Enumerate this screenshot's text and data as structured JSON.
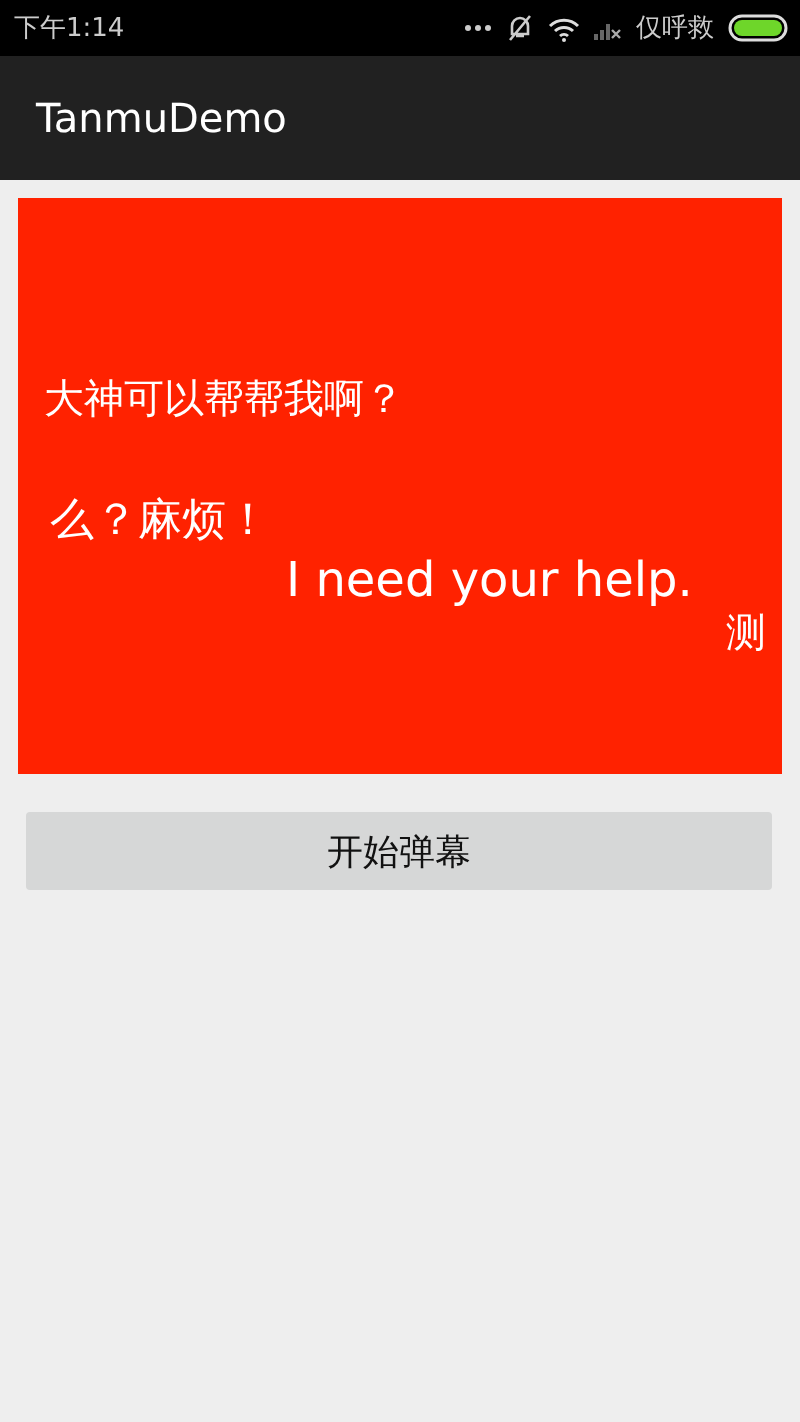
{
  "status_bar": {
    "time": "下午1:14",
    "carrier_text": "仅呼救"
  },
  "app_bar": {
    "title": "TanmuDemo"
  },
  "danmaku": [
    {
      "text": "大神可以帮帮我啊？"
    },
    {
      "text": "么？麻烦！"
    },
    {
      "text": "I need your help."
    },
    {
      "text": "测"
    }
  ],
  "buttons": [
    {
      "label": "开始弹幕"
    }
  ]
}
